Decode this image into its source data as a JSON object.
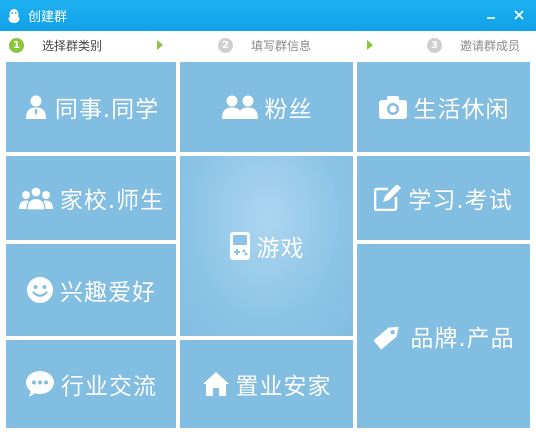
{
  "window": {
    "title": "创建群",
    "icon": "qq-penguin-icon",
    "controls": [
      {
        "name": "minimize-button",
        "icon": "minimize-icon"
      },
      {
        "name": "close-button",
        "icon": "close-icon"
      }
    ]
  },
  "steps": [
    {
      "number": "1",
      "label": "选择群类别",
      "active": true
    },
    {
      "number": "2",
      "label": "填写群信息",
      "active": false
    },
    {
      "number": "3",
      "label": "邀请群成员",
      "active": false
    }
  ],
  "colors": {
    "titlebar": "#1eb1f2",
    "tile": "#82bde2",
    "step_active": "#8cc63f",
    "step_inactive": "#cfcfcf",
    "arrow": "#8cc63f"
  },
  "categories": [
    {
      "id": "colleague",
      "label": "同事.同学",
      "icon": "person-icon"
    },
    {
      "id": "fans",
      "label": "粉丝",
      "icon": "people-icon"
    },
    {
      "id": "leisure",
      "label": "生活休闲",
      "icon": "camera-icon"
    },
    {
      "id": "school",
      "label": "家校.师生",
      "icon": "group-icon"
    },
    {
      "id": "game",
      "label": "游戏",
      "icon": "gamepad-icon"
    },
    {
      "id": "exam",
      "label": "学习.考试",
      "icon": "edit-icon"
    },
    {
      "id": "hobby",
      "label": "兴趣爱好",
      "icon": "smile-icon"
    },
    {
      "id": "brand",
      "label": "品牌.产品",
      "icon": "tag-icon"
    },
    {
      "id": "industry",
      "label": "行业交流",
      "icon": "chat-icon"
    },
    {
      "id": "realestate",
      "label": "置业安家",
      "icon": "home-icon"
    }
  ]
}
